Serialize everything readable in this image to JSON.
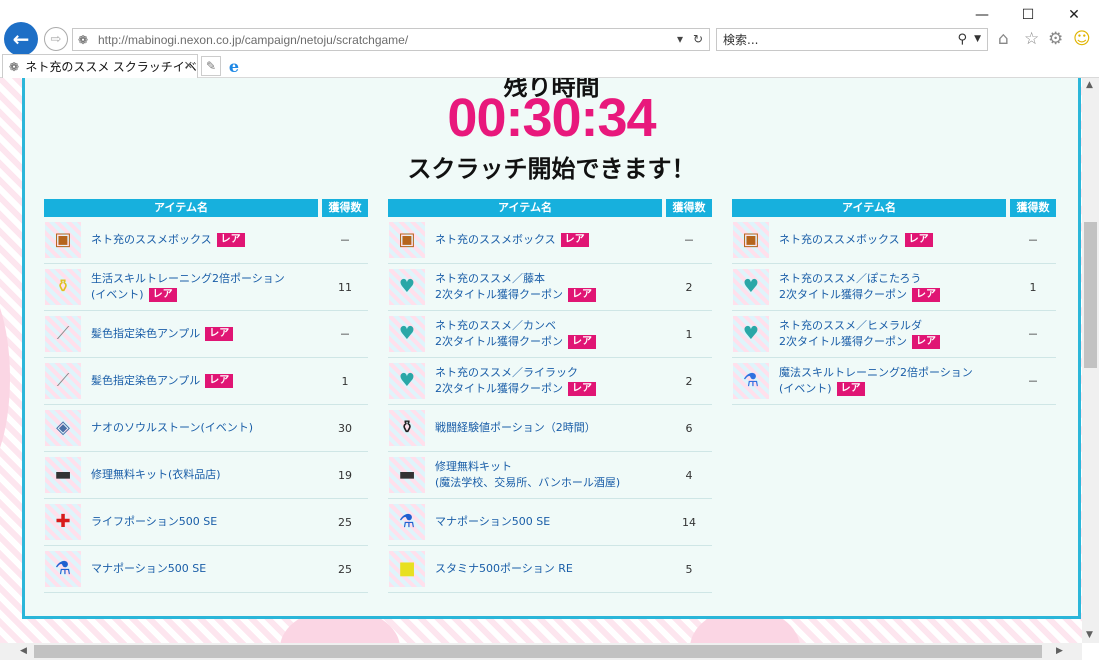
{
  "browser": {
    "url": "http://mabinogi.nexon.co.jp/campaign/netoju/scratchgame/",
    "search_placeholder": "検索...",
    "tab_title": "ネト充のススメ スクラッチイベン..."
  },
  "page": {
    "timer_label": "残り時間",
    "timer": "00:30:34",
    "subtitle": "スクラッチ開始できます！",
    "header_name": "アイテム名",
    "header_count": "獲得数",
    "rare_label": "レア"
  },
  "columns": [
    {
      "items": [
        {
          "icon": "treasure-chest-icon",
          "name": "ネト充のススメボックス",
          "line2": "",
          "rare": true,
          "count": "－"
        },
        {
          "icon": "potion-bottle-icon",
          "name": "生活スキルトレーニング2倍ポーション",
          "line2": "(イベント)",
          "rare": true,
          "count": "11"
        },
        {
          "icon": "dye-ampoule-icon",
          "name": "髪色指定染色アンプル",
          "line2": "",
          "rare": true,
          "count": "－"
        },
        {
          "icon": "dye-ampoule-icon",
          "name": "髪色指定染色アンプル",
          "line2": "",
          "rare": true,
          "count": "1"
        },
        {
          "icon": "soul-stone-icon",
          "name": "ナオのソウルストーン(イベント)",
          "line2": "",
          "rare": false,
          "count": "30"
        },
        {
          "icon": "repair-kit-icon",
          "name": "修理無料キット(衣料品店)",
          "line2": "",
          "rare": false,
          "count": "19"
        },
        {
          "icon": "life-potion-icon",
          "name": "ライフポーション500 SE",
          "line2": "",
          "rare": false,
          "count": "25"
        },
        {
          "icon": "mana-potion-icon",
          "name": "マナポーション500 SE",
          "line2": "",
          "rare": false,
          "count": "25"
        }
      ]
    },
    {
      "items": [
        {
          "icon": "treasure-chest-icon",
          "name": "ネト充のススメボックス",
          "line2": "",
          "rare": true,
          "count": "－"
        },
        {
          "icon": "coupon-icon",
          "name": "ネト充のススメ／藤本",
          "line2": "2次タイトル獲得クーポン",
          "rare": true,
          "count": "2"
        },
        {
          "icon": "coupon-icon",
          "name": "ネト充のススメ／カンベ",
          "line2": "2次タイトル獲得クーポン",
          "rare": true,
          "count": "1"
        },
        {
          "icon": "coupon-icon",
          "name": "ネト充のススメ／ライラック",
          "line2": "2次タイトル獲得クーポン",
          "rare": true,
          "count": "2"
        },
        {
          "icon": "exp-potion-icon",
          "name": "戦闘経験値ポーション（2時間）",
          "line2": "",
          "rare": false,
          "count": "6"
        },
        {
          "icon": "repair-kit-icon",
          "name": "修理無料キット",
          "line2": "(魔法学校、交易所、バンホール酒屋)",
          "rare": false,
          "count": "4"
        },
        {
          "icon": "mana-potion-icon",
          "name": "マナポーション500 SE",
          "line2": "",
          "rare": false,
          "count": "14"
        },
        {
          "icon": "stamina-potion-icon",
          "name": "スタミナ500ポーション RE",
          "line2": "",
          "rare": false,
          "count": "5"
        }
      ]
    },
    {
      "items": [
        {
          "icon": "treasure-chest-icon",
          "name": "ネト充のススメボックス",
          "line2": "",
          "rare": true,
          "count": "－"
        },
        {
          "icon": "coupon-icon",
          "name": "ネト充のススメ／ぽこたろう",
          "line2": "2次タイトル獲得クーポン",
          "rare": true,
          "count": "1"
        },
        {
          "icon": "coupon-icon",
          "name": "ネト充のススメ／ヒメラルダ",
          "line2": "2次タイトル獲得クーポン",
          "rare": true,
          "count": "－"
        },
        {
          "icon": "magic-potion-icon",
          "name": "魔法スキルトレーニング2倍ポーション",
          "line2": "(イベント)",
          "rare": true,
          "count": "－"
        }
      ]
    }
  ],
  "colors": {
    "accent_pink": "#e8187c",
    "header_blue": "#17b0dd",
    "panel_border": "#2bb6d9",
    "rare_badge": "#e01574",
    "link_blue": "#1a5ea8"
  }
}
